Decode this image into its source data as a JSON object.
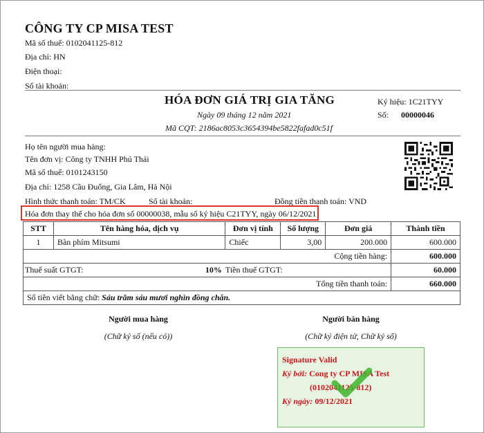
{
  "seller": {
    "company_name": "CÔNG TY CP MISA TEST",
    "tax_code": "Mã số thuế: 0102041125-812",
    "address": "Địa chỉ: HN",
    "phone": "Điện thoại:",
    "account": "Số tài khoản:"
  },
  "invoice": {
    "title": "HÓA ĐƠN GIÁ TRỊ GIA TĂNG",
    "date": "Ngày 09 tháng 12 năm 2021",
    "cqt_code": "Mã CQT: 2186ac8053c3654394be5822fafad0c51f",
    "symbol": "Ký hiệu: 1C21TYY",
    "number_label": "Số:",
    "number": "00000046"
  },
  "buyer": {
    "name": "Họ tên người mua hàng:",
    "unit": "Tên đơn vị: Công ty TNHH Phú Thái",
    "tax_code": "Mã số thuế: 0101243150",
    "address": "Địa chỉ: 1258 Cầu Đuống, Gia Lâm, Hà Nội",
    "payment": "Hình thức thanh toán: TM/CK",
    "account": "Số tài khoản:",
    "currency": "Đồng tiền thanh toán: VND",
    "replacement_note": "Hóa đơn thay thế cho hóa đơn số 00000038, mẫu số ký hiệu C21TYY, ngày 06/12/2021"
  },
  "table": {
    "headers": [
      "STT",
      "Tên hàng hóa, dịch vụ",
      "Đơn vị tính",
      "Số lượng",
      "Đơn giá",
      "Thành tiền"
    ],
    "rows": [
      [
        "1",
        "Bàn phím Mitsumi",
        "Chiếc",
        "3,00",
        "200.000",
        "600.000"
      ]
    ],
    "subtotal_label": "Cộng tiền hàng:",
    "subtotal_value": "600.000",
    "vat_rate_label": "Thuế suất GTGT:",
    "vat_rate_value": "10%",
    "vat_amount_label": "Tiền thuế GTGT:",
    "vat_amount_value": "60.000",
    "total_label": "Tổng tiền thanh toán:",
    "total_value": "660.000",
    "in_words_label": "Số tiền viết bằng chữ:",
    "in_words_value": "Sáu trăm sáu mươi nghìn đồng chẵn."
  },
  "signatures": {
    "buyer_title": "Người mua hàng",
    "buyer_note": "(Chữ ký số (nếu có))",
    "seller_title": "Người bán hàng",
    "seller_note": "(Chữ ký điện tử, Chữ ký số)"
  },
  "signature_valid": {
    "status": "Signature Valid",
    "signed_by_label": "Ký bởi:",
    "signed_by_value": "Cong ty CP MISA Test",
    "signer_code": "(0102041125-812)",
    "signed_date_label": "Ký ngày:",
    "signed_date_value": "09/12/2021",
    "bg_color": "#e7f4e1",
    "text_color": "#c8161d",
    "check_color": "#3fb42b"
  },
  "colors": {
    "highlight_border": "#d9342b"
  }
}
